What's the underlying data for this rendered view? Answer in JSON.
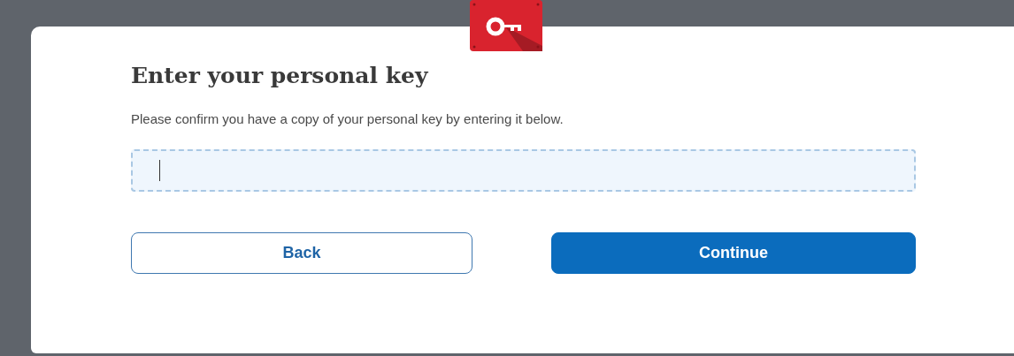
{
  "dialog": {
    "title": "Enter your personal key",
    "description": "Please confirm you have a copy of your personal key by entering it below.",
    "key_field": {
      "focused": true
    },
    "buttons": [
      {
        "label": "Back",
        "kind": "secondary"
      },
      {
        "label": "Continue",
        "kind": "primary"
      }
    ]
  }
}
